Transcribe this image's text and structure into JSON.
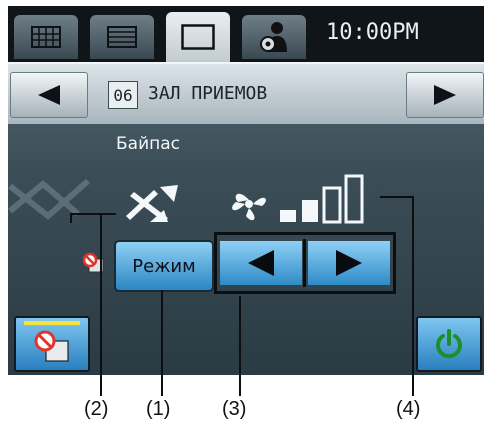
{
  "tabs": [
    {
      "icon": "grid-icon"
    },
    {
      "icon": "list-icon"
    },
    {
      "icon": "single-view-icon"
    },
    {
      "icon": "user-settings-icon"
    }
  ],
  "clock": "10:00PM",
  "room": {
    "number": "06",
    "name": "ЗАЛ ПРИЕМОВ"
  },
  "bypass_label": "Байпас",
  "mode_button": "Режим",
  "fan_speed_level": 2,
  "fan_speed_max": 4,
  "colors": {
    "accent_blue": "#2b86c2",
    "power_green": "#2fbf3a"
  },
  "callouts": [
    "(2)",
    "(1)",
    "(3)",
    "(4)"
  ]
}
